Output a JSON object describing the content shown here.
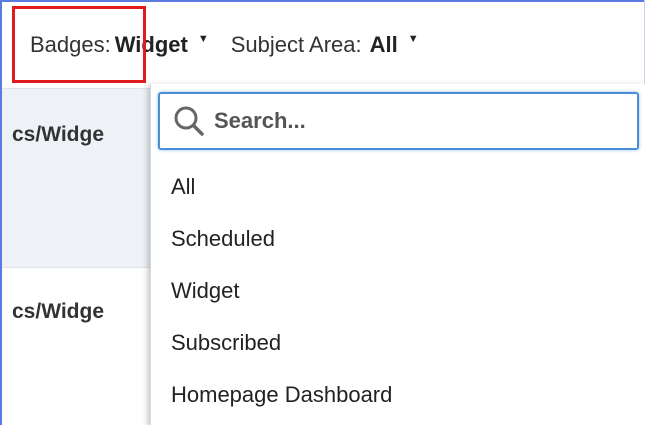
{
  "filters": {
    "badges": {
      "label": "Badges:",
      "value": "Widget"
    },
    "subject_area": {
      "label": "Subject Area:",
      "value": "All"
    }
  },
  "background_rows": [
    {
      "text": "cs/Widge"
    },
    {
      "text": "cs/Widge"
    }
  ],
  "dropdown": {
    "search_placeholder": "Search...",
    "options": [
      "All",
      "Scheduled",
      "Widget",
      "Subscribed",
      "Homepage Dashboard"
    ]
  },
  "colors": {
    "highlight": "#e01b1b",
    "search_border": "#4a8fd6",
    "frame": "#5b7be0"
  },
  "icons": {
    "search": "search-icon",
    "caret": "caret-down-icon"
  }
}
